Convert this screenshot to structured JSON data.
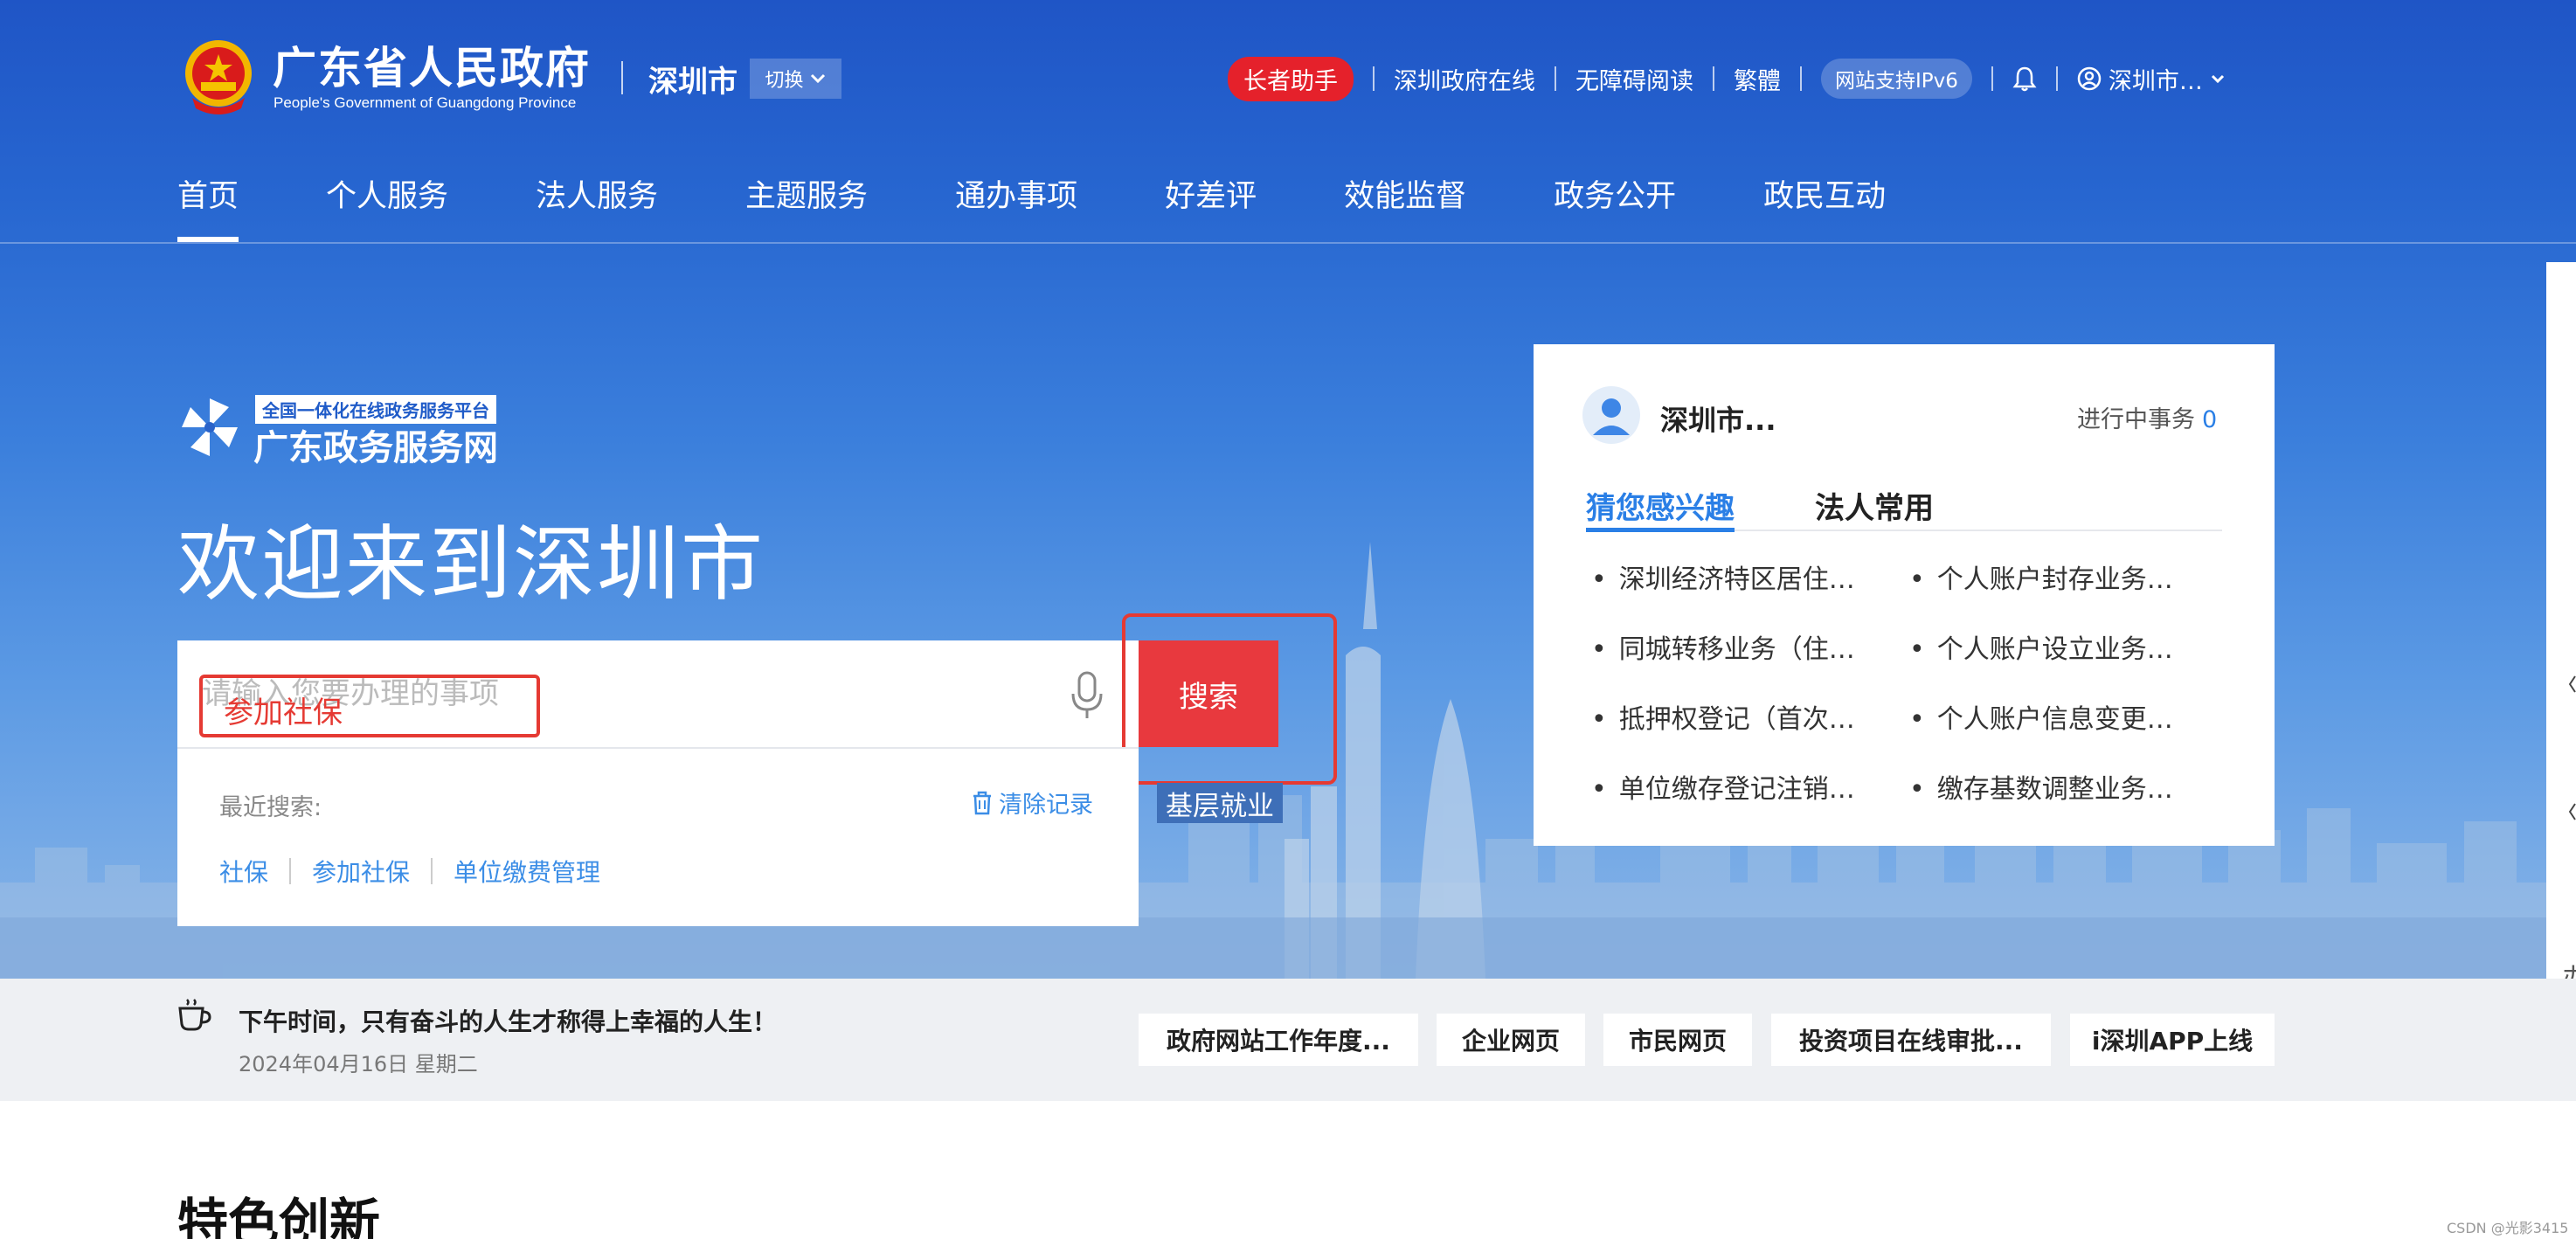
{
  "header": {
    "title": "广东省人民政府",
    "subtitle": "People's Government of Guangdong Province",
    "city": "深圳市",
    "switch_label": "切换",
    "top_links": {
      "elder": "长者助手",
      "online": "深圳政府在线",
      "accessible": "无障碍阅读",
      "traditional": "繁體",
      "ipv6": "网站支持IPv6",
      "user": "深圳市…"
    }
  },
  "nav": {
    "items": [
      "首页",
      "个人服务",
      "法人服务",
      "主题服务",
      "通办事项",
      "好差评",
      "效能监督",
      "政务公开",
      "政民互动"
    ],
    "active_index": 0
  },
  "platform": {
    "badge": "全国一体化在线政务服务平台",
    "name": "广东政务服务网"
  },
  "welcome": "欢迎来到深圳市",
  "search": {
    "placeholder": "请输入您要办理的事项",
    "value": "参加社保",
    "button": "搜索",
    "tag": "基层就业",
    "recent_label": "最近搜索:",
    "clear_label": "清除记录",
    "history": [
      "社保",
      "参加社保",
      "单位缴费管理"
    ]
  },
  "card": {
    "user": "深圳市...",
    "progress_label": "进行中事务",
    "progress_count": "0",
    "tabs": [
      "猜您感兴趣",
      "法人常用"
    ],
    "items": [
      "深圳经济特区居住…",
      "个人账户封存业务…",
      "同城转移业务（住…",
      "个人账户设立业务…",
      "抵押权登记（首次…",
      "个人账户信息变更…",
      "单位缴存登记注销…",
      "缴存基数调整业务…"
    ]
  },
  "strip": {
    "quote": "下午时间，只有奋斗的人生才称得上幸福的人生！",
    "date": "2024年04月16日 星期二",
    "quick_links": [
      "政府网站工作年度...",
      "企业网页",
      "市民网页",
      "投资项目在线审批...",
      "i深圳APP上线"
    ]
  },
  "section_title": "特色创新",
  "edge_char": "办",
  "watermark": "CSDN @光影3415",
  "colors": {
    "header_blue": "#1f55c6",
    "search_red": "#e8393e",
    "link_blue": "#3b8de6",
    "accent_blue": "#2a7fe6",
    "annotation_red": "#e53a33"
  },
  "icons": [
    "national-emblem-icon",
    "chevron-down-icon",
    "bell-icon",
    "user-icon",
    "pinwheel-logo-icon",
    "mic-icon",
    "trash-icon",
    "avatar-icon",
    "coffee-cup-icon"
  ]
}
